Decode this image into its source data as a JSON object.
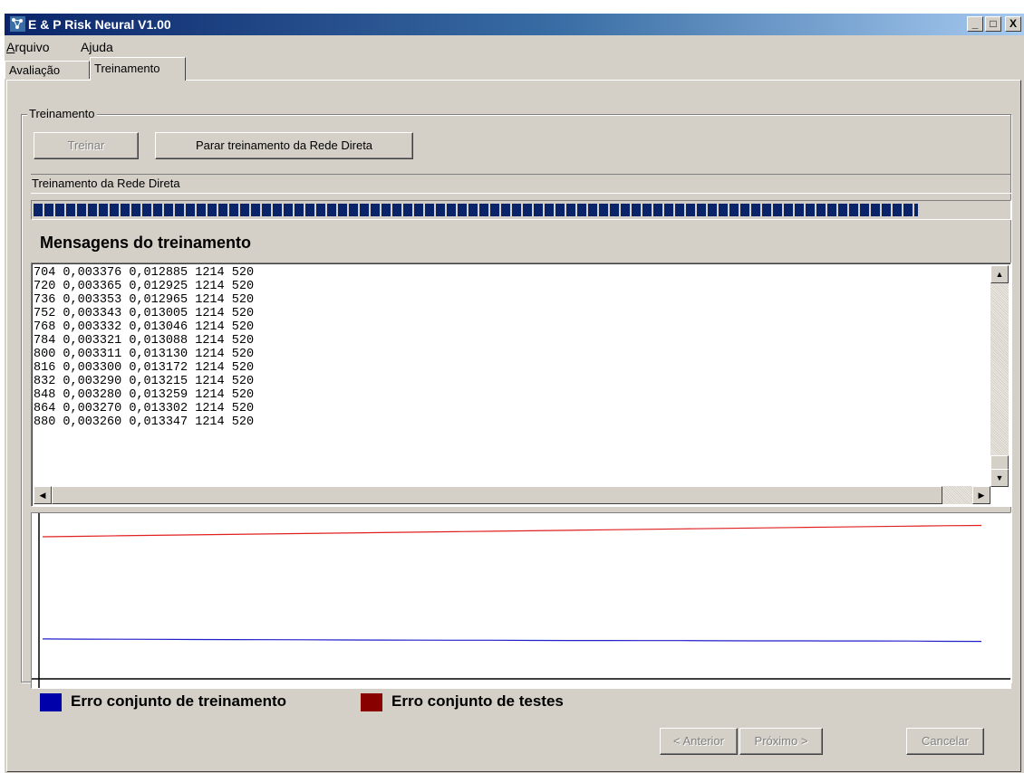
{
  "window": {
    "title": "E & P Risk Neural V1.00",
    "controls": {
      "minimize": "_",
      "maximize": "□",
      "close": "X"
    }
  },
  "menu": {
    "items": [
      {
        "label": "Arquivo",
        "accel": "A",
        "rest": "rquivo"
      },
      {
        "label": "Ajuda",
        "pre": "A",
        "accel": "j",
        "rest": "uda"
      }
    ]
  },
  "tabs": [
    {
      "label": "Avaliação",
      "active": false
    },
    {
      "label": "Treinamento",
      "active": true
    }
  ],
  "training_group": {
    "legend": "Treinamento",
    "train_button": "Treinar",
    "stop_button": "Parar treinamento da Rede Direta",
    "status_label": "Treinamento da Rede Direta",
    "progress_fraction": 0.907,
    "section_title": "Mensagens do treinamento",
    "log_lines": [
      "704 0,003376 0,012885 1214 520",
      "720 0,003365 0,012925 1214 520",
      "736 0,003353 0,012965 1214 520",
      "752 0,003343 0,013005 1214 520",
      "768 0,003332 0,013046 1214 520",
      "784 0,003321 0,013088 1214 520",
      "800 0,003311 0,013130 1214 520",
      "816 0,003300 0,013172 1214 520",
      "832 0,003290 0,013215 1214 520",
      "848 0,003280 0,013259 1214 520",
      "864 0,003270 0,013302 1214 520",
      "880 0,003260 0,013347 1214 520"
    ]
  },
  "chart_data": {
    "type": "line",
    "x": [
      0,
      1,
      2,
      3,
      4,
      5,
      6,
      7,
      8,
      9,
      10,
      11,
      12,
      13,
      14,
      15,
      16,
      17,
      18,
      19,
      20,
      21,
      22,
      23,
      24,
      25
    ],
    "series": [
      {
        "name": "Erro conjunto de treinamento",
        "color": "#0000aa",
        "stroke": "#1f1fcc",
        "values": [
          0.00347,
          0.00346,
          0.00345,
          0.00344,
          0.00343,
          0.00342,
          0.00341,
          0.0034,
          0.00339,
          0.00338,
          0.00337,
          0.00336,
          0.00336,
          0.00335,
          0.00334,
          0.00334,
          0.00333,
          0.00333,
          0.00332,
          0.00331,
          0.00331,
          0.0033,
          0.0033,
          0.00329,
          0.00327,
          0.00326
        ]
      },
      {
        "name": "Erro conjunto de testes",
        "color": "#880000",
        "stroke": "#e02020",
        "values": [
          0.01237,
          0.01241,
          0.01245,
          0.01249,
          0.01253,
          0.01257,
          0.01261,
          0.01265,
          0.01269,
          0.01273,
          0.01277,
          0.01281,
          0.01285,
          0.01289,
          0.01293,
          0.01297,
          0.01301,
          0.01305,
          0.01309,
          0.01313,
          0.01317,
          0.01321,
          0.01325,
          0.01329,
          0.01333,
          0.01335
        ]
      }
    ],
    "ylim": [
      0,
      0.0141
    ],
    "grid": false,
    "legend_position": "bottom",
    "axis_color": "#000000"
  },
  "footer": {
    "prev_button": "< Anterior",
    "next_button": "Próximo >",
    "cancel_button": "Cancelar"
  }
}
